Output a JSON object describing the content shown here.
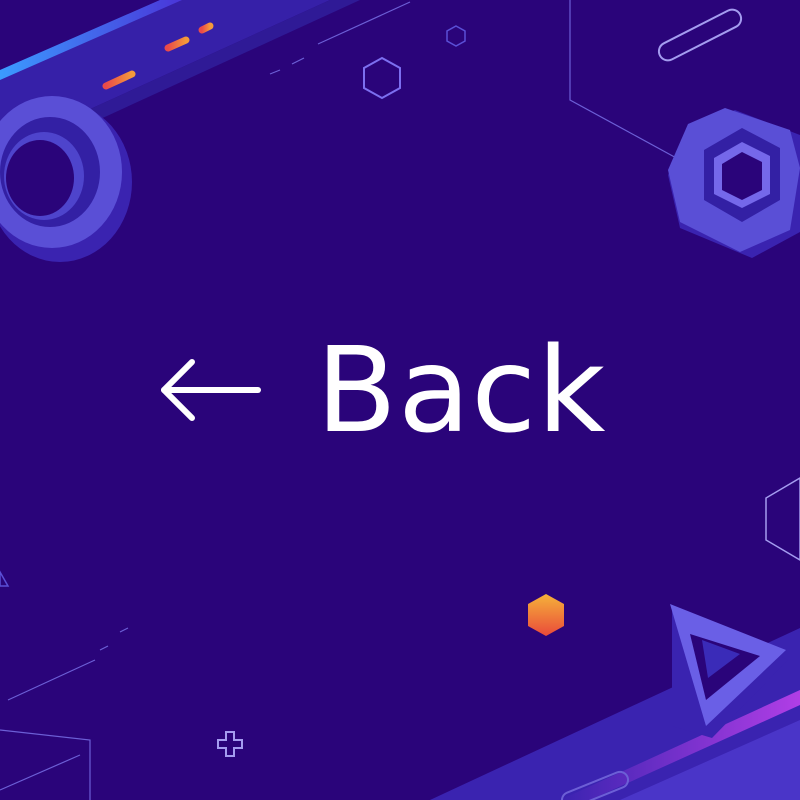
{
  "back_button": {
    "label": "Back",
    "icon": "arrow-left-icon"
  },
  "colors": {
    "background": "#2a047a",
    "shape_primary": "#5a4fd6",
    "shape_light": "#7568ea",
    "shape_dark": "#3a23b0",
    "accent_orange": "#f59a3a",
    "accent_red": "#ea4a4a",
    "accent_blue": "#3b9bff",
    "accent_magenta": "#b13ee6",
    "text": "#ffffff"
  }
}
